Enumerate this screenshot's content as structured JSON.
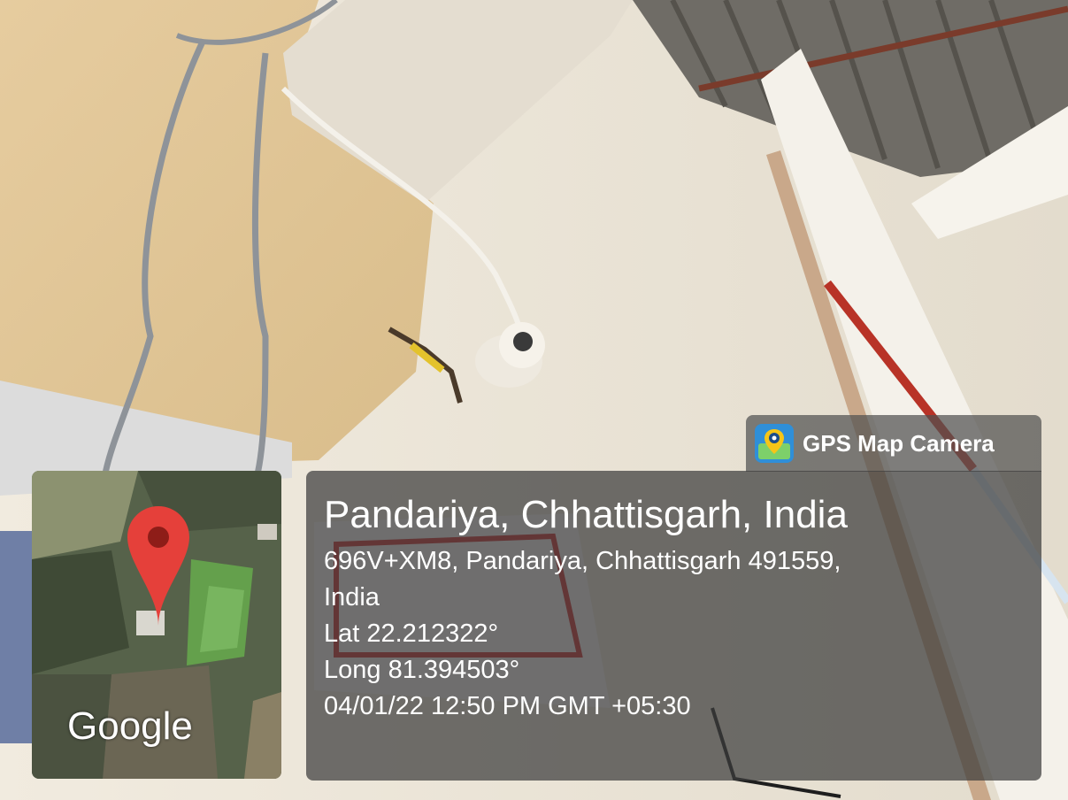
{
  "app_badge": {
    "label": "GPS Map Camera",
    "icon": "gps-map-camera-app-icon"
  },
  "map": {
    "watermark": "Google",
    "marker_icon": "location-pin-icon"
  },
  "location": {
    "place": "Pandariya, Chhattisgarh, India",
    "address_line1": "696V+XM8, Pandariya, Chhattisgarh 491559,",
    "address_line2": "India",
    "latitude": "Lat 22.212322°",
    "longitude": "Long 81.394503°",
    "datetime": "04/01/22 12:50 PM GMT +05:30"
  },
  "colors": {
    "overlay": "#3c3c3c",
    "pin": "#e5403a",
    "wall": "#e2c99d"
  }
}
